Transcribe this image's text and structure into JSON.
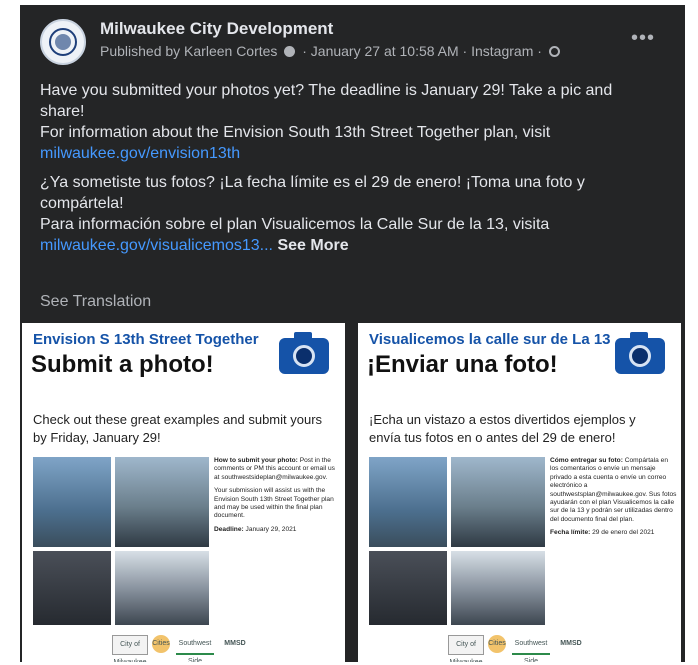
{
  "post": {
    "page_name": "Milwaukee City Development",
    "published_by": "Published by Karleen Cortes",
    "timestamp": "January 27 at 10:58 AM",
    "source": "Instagram",
    "more_icon": "more-dots-icon",
    "paragraphs": {
      "en_1": "Have you submitted your photos yet? The deadline is January 29! Take a pic and share!",
      "en_2": "For information about the Envision South 13th Street Together plan, visit",
      "en_link": "milwaukee.gov/envision13th",
      "es_1": "¿Ya sometiste tus fotos? ¡La fecha límite es el 29 de enero! ¡Toma una foto y compártela!",
      "es_2": "Para información sobre el plan Visualicemos la Calle Sur de la 13, visita",
      "es_link": "milwaukee.gov/visualicemos13...",
      "see_more": "See More"
    },
    "see_translation": "See Translation"
  },
  "cards": {
    "left": {
      "title": "Envision S 13th Street Together",
      "heading": "Submit a photo!",
      "subtitle": "Check out these great examples and submit yours by Friday, January 29!",
      "how_label": "How to submit your photo:",
      "how_text": " Post in the comments or PM this account or email us at southwestsideplan@milwaukee.gov.",
      "assist_text": "Your submission will assist us with the Envision South 13th Street Together plan and may be used within the final plan document.",
      "deadline_label": "Deadline:",
      "deadline_text": " January 29, 2021"
    },
    "right": {
      "title": "Visualicemos la calle sur de La 13",
      "heading": "¡Enviar una foto!",
      "subtitle": "¡Echa un vistazo a estos divertidos ejemplos y envía tus fotos en o antes del 29 de enero!",
      "how_label": "Cómo entregar su foto:",
      "how_text": " Compártala en los comentarios o envíe un mensaje privado a esta cuenta o envíe un correo electrónico a southwestsplan@milwaukee.gov. Sus fotos ayudarán con el plan Visualicemos la calle sur de la 13 y podrán ser utilizadas dentro del documento final del plan.",
      "deadline_label": "Fecha límite:",
      "deadline_text": " 29 de enero del 2021"
    },
    "logos": {
      "milwaukee": "City of Milwaukee",
      "cities": "Cities",
      "southwest": "Southwest Side",
      "mmsd": "MMSD"
    }
  },
  "colors": {
    "post_bg": "#242526",
    "text": "#e4e6eb",
    "muted": "#b0b3b8",
    "link": "#4599ff",
    "card_blue": "#1553a8"
  }
}
